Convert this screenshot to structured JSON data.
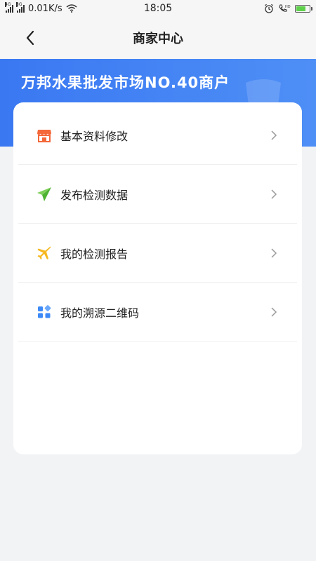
{
  "status_bar": {
    "network_1": "4G",
    "network_2": "3G",
    "speed": "0.01K/s",
    "time": "18:05",
    "battery_color": "#5ed14b"
  },
  "nav": {
    "title": "商家中心",
    "back_icon": "chevron-left-icon"
  },
  "banner": {
    "title": "万邦水果批发市场NO.40商户",
    "background": "#3a78f2"
  },
  "menu": {
    "items": [
      {
        "label": "基本资料修改",
        "icon": "shop-icon",
        "icon_color": "#f4683a"
      },
      {
        "label": "发布检测数据",
        "icon": "paper-plane-icon",
        "icon_color": "#5bbf3a"
      },
      {
        "label": "我的检测报告",
        "icon": "airplane-icon",
        "icon_color": "#f6b820"
      },
      {
        "label": "我的溯源二维码",
        "icon": "grid-icon",
        "icon_color": "#3d8af7"
      }
    ]
  }
}
